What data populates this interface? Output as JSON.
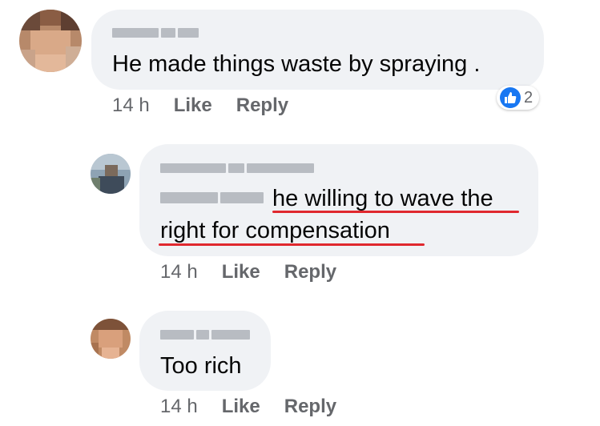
{
  "comments": [
    {
      "text": "He made things waste by spraying .",
      "time": "14 h",
      "like_label": "Like",
      "reply_label": "Reply",
      "reaction": {
        "icon": "thumbs-up-icon",
        "count": "2",
        "color": "#1877f2"
      }
    },
    {
      "text_line1": "he willing to wave the",
      "text_line2": "right for compensation",
      "underline_color": "#e0282e",
      "time": "14 h",
      "like_label": "Like",
      "reply_label": "Reply"
    },
    {
      "text": "Too rich",
      "time": "14 h",
      "like_label": "Like",
      "reply_label": "Reply"
    }
  ],
  "colors": {
    "bubble": "#f0f2f5",
    "meta_text": "#65676b",
    "primary_text": "#050505"
  }
}
